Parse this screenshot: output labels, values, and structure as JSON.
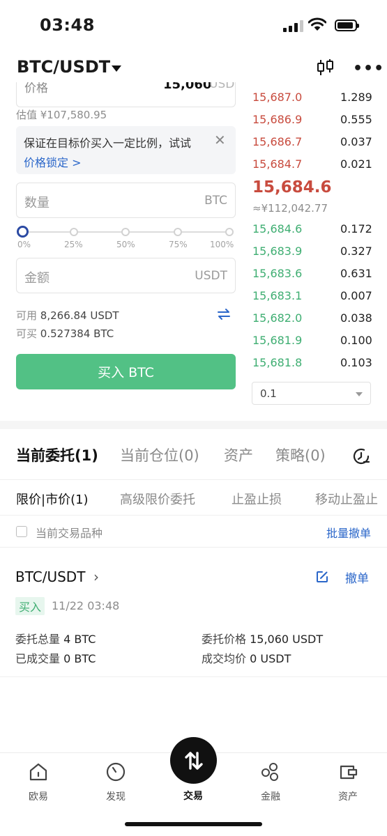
{
  "status_bar": {
    "time": "03:48"
  },
  "header": {
    "pair": "BTC/USDT"
  },
  "form": {
    "price_label": "价格",
    "price_value": "15,060",
    "price_unit": "USDT",
    "estimate": "估值 ¥107,580.95",
    "tip_text": "保证在目标价买入一定比例，试试",
    "tip_link": "价格锁定 >",
    "qty_placeholder": "数量",
    "qty_unit": "BTC",
    "slider_fraction": 0,
    "slider_labels": [
      "0%",
      "25%",
      "50%",
      "75%",
      "100%"
    ],
    "amount_placeholder": "金额",
    "amount_unit": "USDT",
    "available_label": "可用",
    "available_value": "8,266.84 USDT",
    "canbuy_label": "可买",
    "canbuy_value": "0.527384 BTC",
    "buy_button": "买入 BTC"
  },
  "orderbook": {
    "asks": [
      {
        "price": "15,687.0",
        "qty": "1.289"
      },
      {
        "price": "15,686.9",
        "qty": "0.555"
      },
      {
        "price": "15,686.7",
        "qty": "0.037"
      },
      {
        "price": "15,684.7",
        "qty": "0.021"
      }
    ],
    "mid_price": "15,684.6",
    "mid_cny": "≈¥112,042.77",
    "bids": [
      {
        "price": "15,684.6",
        "qty": "0.172"
      },
      {
        "price": "15,683.9",
        "qty": "0.327"
      },
      {
        "price": "15,683.6",
        "qty": "0.631"
      },
      {
        "price": "15,683.1",
        "qty": "0.007"
      },
      {
        "price": "15,682.0",
        "qty": "0.038"
      },
      {
        "price": "15,681.9",
        "qty": "0.100"
      },
      {
        "price": "15,681.8",
        "qty": "0.103"
      }
    ],
    "depth": "0.1"
  },
  "tabs": [
    "当前委托(1)",
    "当前仓位(0)",
    "资产",
    "策略(0)"
  ],
  "subtabs": [
    "限价|市价(1)",
    "高级限价委托",
    "止盈止损",
    "移动止盈止"
  ],
  "filter": {
    "label": "当前交易品种",
    "batch_cancel": "批量撤单"
  },
  "order": {
    "pair": "BTC/USDT",
    "cancel": "撤单",
    "side": "买入",
    "time": "11/22 03:48",
    "total_label": "委托总量",
    "total_value": "4 BTC",
    "price_label": "委托价格",
    "price_value": "15,060 USDT",
    "filled_label": "已成交量",
    "filled_value": "0 BTC",
    "avg_label": "成交均价",
    "avg_value": "0 USDT"
  },
  "nav": [
    {
      "label": "欧易",
      "icon": "home-icon"
    },
    {
      "label": "发现",
      "icon": "compass-icon"
    },
    {
      "label": "交易",
      "icon": "swap-arrows-icon"
    },
    {
      "label": "金融",
      "icon": "finance-icon"
    },
    {
      "label": "资产",
      "icon": "wallet-icon"
    }
  ],
  "colors": {
    "ask": "#c84b3e",
    "bid": "#3fae72",
    "buy_button": "#52c185",
    "link": "#2a66c9"
  }
}
